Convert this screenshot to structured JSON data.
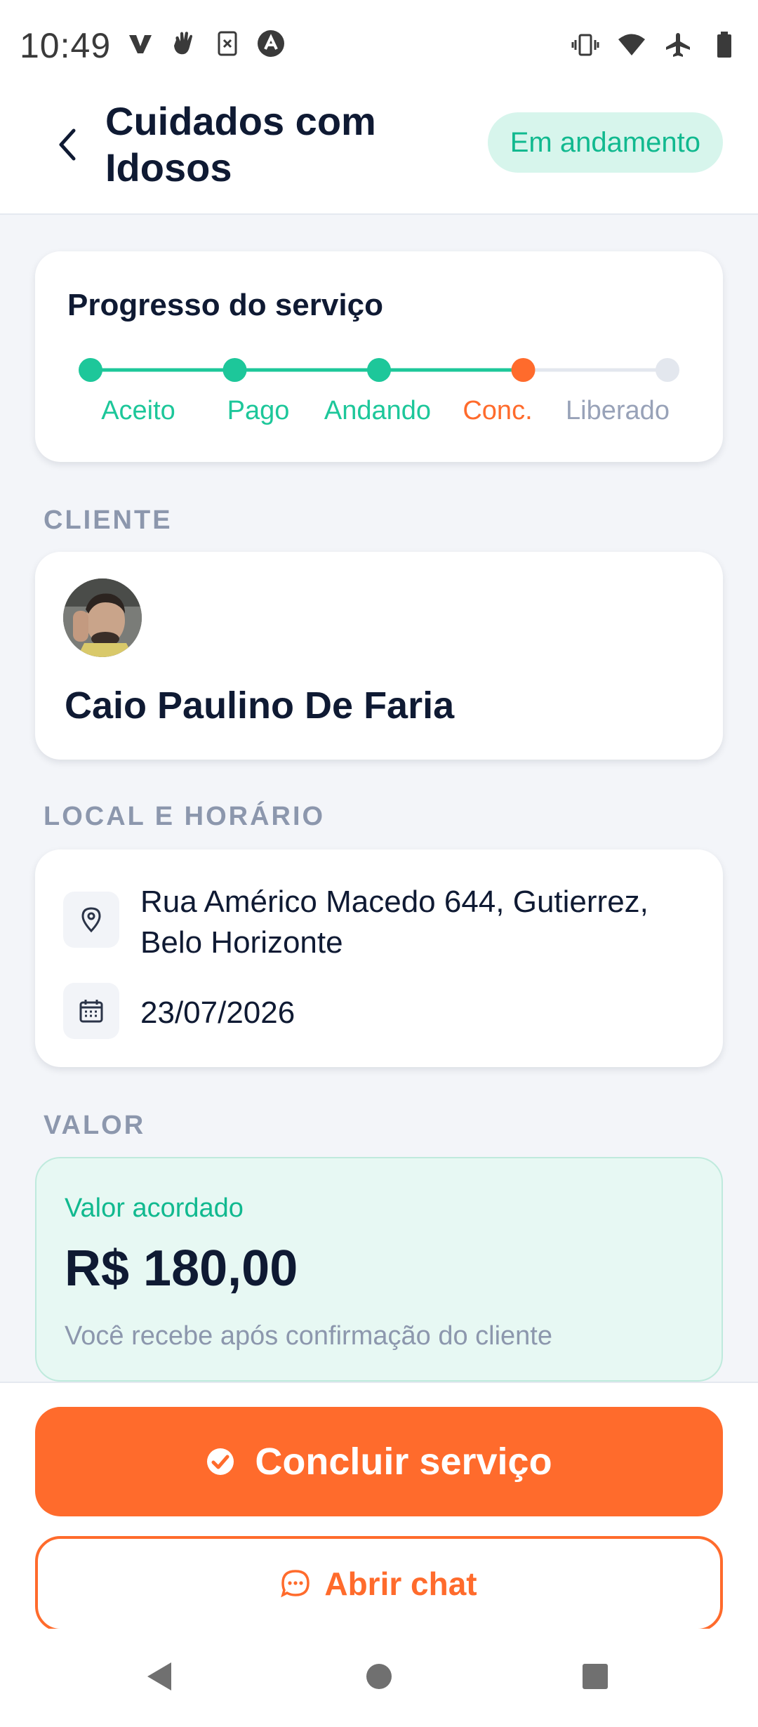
{
  "status_bar": {
    "time": "10:49"
  },
  "header": {
    "title": "Cuidados com Idosos",
    "status_badge": "Em andamento"
  },
  "progress": {
    "title": "Progresso do serviço",
    "steps": [
      {
        "label": "Aceito",
        "state": "done"
      },
      {
        "label": "Pago",
        "state": "done"
      },
      {
        "label": "Andando",
        "state": "done"
      },
      {
        "label": "Conc.",
        "state": "current"
      },
      {
        "label": "Liberado",
        "state": "pending"
      }
    ],
    "colors": {
      "done": "#1DC79A",
      "current": "#FF6B2C",
      "pending": "#E3E7EE"
    }
  },
  "client": {
    "section_label": "CLIENTE",
    "name": "Caio Paulino De Faria"
  },
  "location": {
    "section_label": "LOCAL E HORÁRIO",
    "address": "Rua Américo Macedo 644, Gutierrez, Belo Horizonte",
    "date": "23/07/2026"
  },
  "value": {
    "section_label": "VALOR",
    "caption": "Valor acordado",
    "amount": "R$ 180,00",
    "note": "Você recebe após confirmação do cliente"
  },
  "actions": {
    "primary_label": "Concluir serviço",
    "secondary_label": "Abrir chat"
  },
  "theme": {
    "accent": "#FF6B2C",
    "success": "#1DC79A",
    "text_dark": "#0F1A33",
    "muted": "#8C97AD"
  }
}
